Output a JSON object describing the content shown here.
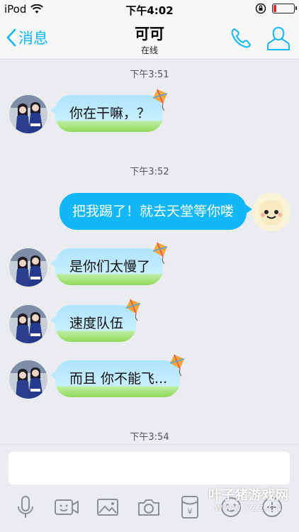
{
  "status_bar": {
    "carrier": "iPod",
    "time": "下午4:02",
    "battery_level": 0.12,
    "battery_color": "#e5262b"
  },
  "nav": {
    "back_label": "消息",
    "title": "可可",
    "subtitle": "在线",
    "accent": "#12b7f5"
  },
  "messages": [
    {
      "type": "time",
      "text": "下午3:51"
    },
    {
      "type": "in",
      "text": "你在干嘛，？"
    },
    {
      "type": "time",
      "text": "下午3:52"
    },
    {
      "type": "out",
      "text": "把我踢了！就去天堂等你喽"
    },
    {
      "type": "in",
      "text": "是你们太慢了"
    },
    {
      "type": "in",
      "text": "速度队伍"
    },
    {
      "type": "in",
      "text": "而且 你不能飞..."
    },
    {
      "type": "time",
      "text": "下午3:54"
    }
  ],
  "input": {
    "value": "",
    "placeholder": ""
  },
  "toolbar_icons": [
    "microphone-icon",
    "video-icon",
    "image-icon",
    "camera-icon",
    "red-packet-icon",
    "emoji-icon",
    "plus-icon"
  ],
  "watermark": {
    "main": "叶子猪游戏网",
    "sub": "WWW.YZZ.CN"
  }
}
